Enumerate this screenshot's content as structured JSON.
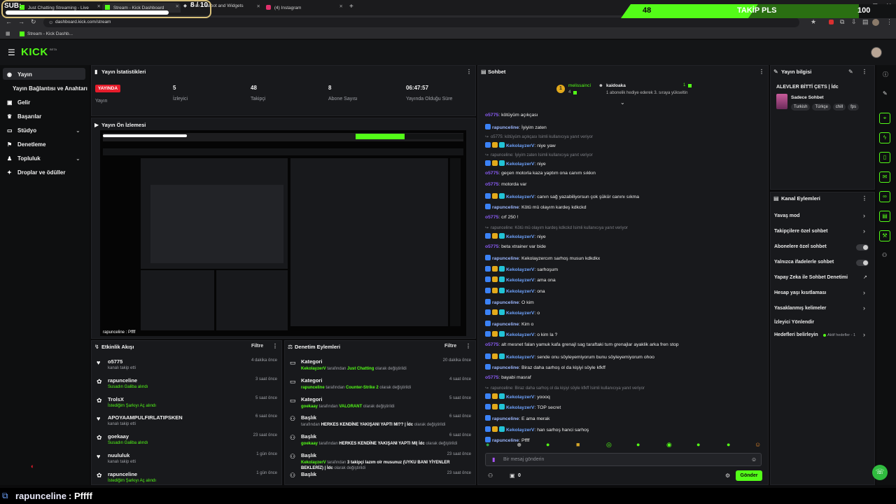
{
  "browser": {
    "tabs": [
      {
        "label": "Just Chatting Streaming - Live"
      },
      {
        "label": "Stream - Kick Dashboard"
      },
      {
        "label": "Free Chatbot and Widgets"
      },
      {
        "label": "(4) Instagram"
      }
    ],
    "url": "dashboard.kick.com/stream",
    "bookmark": "Stream - Kick Dashb..."
  },
  "overlay": {
    "sub_label": "SUB:",
    "sub_count": "8 / 10",
    "follow_count": "48",
    "follow_text": "TAKİP PLS",
    "follow_goal": "100"
  },
  "header": {
    "logo": "KICK",
    "logo_sup": "BETA"
  },
  "sidebar": {
    "items": [
      {
        "label": "Yayın"
      },
      {
        "label": "Yayın Bağlantısı ve Anahtarı"
      },
      {
        "label": "Gelir"
      },
      {
        "label": "Başarılar"
      },
      {
        "label": "Stüdyo"
      },
      {
        "label": "Denetleme"
      },
      {
        "label": "Topluluk"
      },
      {
        "label": "Droplar ve ödüller"
      }
    ]
  },
  "stats": {
    "title": "Yayın İstatistikleri",
    "live_badge": "YAYINDA",
    "items": [
      {
        "value": "",
        "label": "Yayın"
      },
      {
        "value": "5",
        "label": "İzleyici"
      },
      {
        "value": "48",
        "label": "Takipçi"
      },
      {
        "value": "8",
        "label": "Abone Sayısı"
      },
      {
        "value": "06:47:57",
        "label": "Yayında Olduğu Süre"
      }
    ]
  },
  "preview": {
    "title": "Yayın Ön İzlemesi",
    "caption": "rapunceline : Pffff"
  },
  "events": {
    "title": "Etkinlik Akışı",
    "filter": "Filtre",
    "items": [
      {
        "name": "o5775",
        "desc": "kanalı takip etti",
        "time": "4 dakika önce",
        "icon": "heart-icon",
        "green": false
      },
      {
        "name": "rapunceline",
        "desc": "Susadın Galiba alındı",
        "time": "3 saat önce",
        "icon": "reward-icon",
        "green": true
      },
      {
        "name": "TrolsX",
        "desc": "İstediğim Şarkıyı Aç alındı",
        "time": "5 saat önce",
        "icon": "reward-icon",
        "green": true
      },
      {
        "name": "APOYAAMPULFIRLATIPSKEN",
        "desc": "kanalı takip etti",
        "time": "6 saat önce",
        "icon": "heart-icon",
        "green": false
      },
      {
        "name": "goekaay",
        "desc": "Susadın Galiba alındı",
        "time": "23 saat önce",
        "icon": "reward-icon",
        "green": true
      },
      {
        "name": "nuululuk",
        "desc": "kanalı takip etti",
        "time": "1 gün önce",
        "icon": "heart-icon",
        "green": false
      },
      {
        "name": "rapunceline",
        "desc": "İstediğim Şarkıyı Aç alındı",
        "time": "1 gün önce",
        "icon": "reward-icon",
        "green": true
      }
    ]
  },
  "moderation": {
    "title": "Denetim Eylemleri",
    "filter": "Filtre",
    "items": [
      {
        "type": "Kategori",
        "user": "KekolayzerV",
        "mid": " tarafından ",
        "val": "Just Chatting",
        "end": " olarak değiştirildi",
        "time": "20 dakika önce",
        "icon": "category-icon"
      },
      {
        "type": "Kategori",
        "user": "rapunceline",
        "mid": " tarafından ",
        "val": "Counter-Strike 2",
        "end": " olarak değiştirildi",
        "time": "4 saat önce",
        "icon": "category-icon"
      },
      {
        "type": "Kategori",
        "user": "goekaay",
        "mid": " tarafından ",
        "val": "VALORANT",
        "end": " olarak değiştirildi",
        "time": "5 saat önce",
        "icon": "category-icon"
      },
      {
        "type": "Başlık",
        "user": "",
        "mid": "tarafından ",
        "val": "HERKES KENDİNE YAKIŞANI YAPTI MI?? | İdc",
        "end": " olarak değiştirildi",
        "time": "6 saat önce",
        "icon": "title-icon"
      },
      {
        "type": "Başlık",
        "user": "goekaay",
        "mid": " tarafından ",
        "val": "HERKES KENDİNE YAKIŞANI YAPTI MI| İdc",
        "end": " olarak değiştirildi",
        "time": "6 saat önce",
        "icon": "title-icon"
      },
      {
        "type": "Başlık",
        "user": "KekolayzerV",
        "mid": " tarafından ",
        "val": "3 takipçi lazım olr musunuz (UYKU BANI YİYENLER BEKLERİZ) | İdc",
        "end": " olarak değiştirildi",
        "time": "23 saat önce",
        "icon": "title-icon"
      },
      {
        "type": "Başlık",
        "user": "",
        "mid": "",
        "val": "",
        "end": "",
        "time": "23 saat önce",
        "icon": "title-icon"
      }
    ]
  },
  "chat": {
    "title": "Sohbet",
    "pinned": {
      "gifter": "melissaincí",
      "gifter_count": "4",
      "recipient": "kaidoaka",
      "recipient_count": "1",
      "note": "1 abonelik hediye ederek 3. sıraya yükseltin"
    },
    "messages": [
      {
        "kind": "msg",
        "user": "o5775",
        "ucls": "u-purple",
        "text": "kötüyüm açıkçası",
        "badges": 0
      },
      {
        "kind": "msg",
        "user": "rapunceline",
        "ucls": "u-blue",
        "text": "İyiyim zaten",
        "badges": 1
      },
      {
        "kind": "reply",
        "text": "o5775: kötüyüm açıkçası İsimli kullanıcıya yanıt veriyor"
      },
      {
        "kind": "msg",
        "user": "KekolayzerV",
        "ucls": "u-teal",
        "text": "niye yaw",
        "badges": 3
      },
      {
        "kind": "reply",
        "text": "rapunceline: İyiyim zaten İsimli kullanıcıya yanıt veriyor"
      },
      {
        "kind": "msg",
        "user": "KekolayzerV",
        "ucls": "u-teal",
        "text": "niye",
        "badges": 3
      },
      {
        "kind": "msg",
        "user": "o5775",
        "ucls": "u-purple",
        "text": "geçen motorla kaza yaptım ona canım sıkkın",
        "badges": 0
      },
      {
        "kind": "msg",
        "user": "o5775",
        "ucls": "u-purple",
        "text": "motorda var",
        "badges": 0
      },
      {
        "kind": "msg",
        "user": "KekolayzerV",
        "ucls": "u-teal",
        "text": "canın sağ yazabiliyorsun çok şükür canını sıkma",
        "badges": 3
      },
      {
        "kind": "msg",
        "user": "rapunceline",
        "ucls": "u-blue",
        "text": "Kötü mü olayım kardeş kdkckd",
        "badges": 1
      },
      {
        "kind": "msg",
        "user": "o5775",
        "ucls": "u-purple",
        "text": "crf 250 !",
        "badges": 0
      },
      {
        "kind": "reply",
        "text": "rapunceline: Kötü mü olayım kardeş kdkckd İsimli kullanıcıya yanıt veriyor"
      },
      {
        "kind": "msg",
        "user": "KekolayzerV",
        "ucls": "u-teal",
        "text": "niye",
        "badges": 3
      },
      {
        "kind": "msg",
        "user": "o5775",
        "ucls": "u-purple",
        "text": "beta xtrainer var bide",
        "badges": 0
      },
      {
        "kind": "msg",
        "user": "rapunceline",
        "ucls": "u-blue",
        "text": "Kekolayzercım sarhoş musun kdkdkx",
        "badges": 1
      },
      {
        "kind": "msg",
        "user": "KekolayzerV",
        "ucls": "u-teal",
        "text": "sarhoşum",
        "badges": 3
      },
      {
        "kind": "msg",
        "user": "KekolayzerV",
        "ucls": "u-teal",
        "text": "ama ona",
        "badges": 3
      },
      {
        "kind": "msg",
        "user": "KekolayzerV",
        "ucls": "u-teal",
        "text": "ona",
        "badges": 3
      },
      {
        "kind": "msg",
        "user": "rapunceline",
        "ucls": "u-blue",
        "text": "O kim",
        "badges": 1
      },
      {
        "kind": "msg",
        "user": "KekolayzerV",
        "ucls": "u-teal",
        "text": "o",
        "badges": 3
      },
      {
        "kind": "msg",
        "user": "rapunceline",
        "ucls": "u-blue",
        "text": "Kim o",
        "badges": 1
      },
      {
        "kind": "msg",
        "user": "KekolayzerV",
        "ucls": "u-teal",
        "text": "o kim la ?",
        "badges": 3
      },
      {
        "kind": "msg",
        "user": "o5775",
        "ucls": "u-purple",
        "text": "alt mesnet falan yamuk kafa grenajl sag taraftaki tum grenajlar ayaklik arka fren stop",
        "badges": 0
      },
      {
        "kind": "msg",
        "user": "KekolayzerV",
        "ucls": "u-teal",
        "text": "sende onu söyleyemiyorum bunu söyleyemiyorum ohoo",
        "badges": 3
      },
      {
        "kind": "msg",
        "user": "rapunceline",
        "ucls": "u-blue",
        "text": "Biraz daha sarhoş ol da kişiyi söyle kfkff",
        "badges": 1
      },
      {
        "kind": "msg",
        "user": "o5775",
        "ucls": "u-purple",
        "text": "bayabi masraf",
        "badges": 0
      },
      {
        "kind": "reply",
        "text": "rapunceline: Biraz daha sarhoş ol da kişiyi söyle kfkff İsimli kullanıcıya yanıt veriyor"
      },
      {
        "kind": "msg",
        "user": "KekolayzerV",
        "ucls": "u-teal",
        "text": "yoooq",
        "badges": 3
      },
      {
        "kind": "msg",
        "user": "KekolayzerV",
        "ucls": "u-teal",
        "text": "TOP secret",
        "badges": 3
      },
      {
        "kind": "msg",
        "user": "rapunceline",
        "ucls": "u-blue",
        "text": "E ama merak",
        "badges": 1
      },
      {
        "kind": "msg",
        "user": "KekolayzerV",
        "ucls": "u-teal",
        "text": "han sarhoş hanci sarhoş",
        "badges": 3
      },
      {
        "kind": "msg",
        "user": "rapunceline",
        "ucls": "u-blue",
        "text": "Pffff",
        "badges": 1
      }
    ],
    "input_placeholder": "Bir mesaj gönderin",
    "send_label": "Gönder",
    "points": "0"
  },
  "stream_info": {
    "title": "Yayın bilgisi",
    "stream_title": "ALEVLER BİTTİ ÇETS | İdc",
    "category": "Sadece Sohbet",
    "tags": [
      "Turkish",
      "Türkçe",
      "chill",
      "fps"
    ]
  },
  "channel_actions": {
    "title": "Kanal Eylemleri",
    "items": [
      {
        "label": "Yavaş mod",
        "control": "chevron"
      },
      {
        "label": "Takipçilere özel sohbet",
        "control": "chevron"
      },
      {
        "label": "Abonelere özel sohbet",
        "control": "toggle"
      },
      {
        "label": "Yalnızca ifadelerle sohbet",
        "control": "toggle"
      },
      {
        "label": "Yapay Zeka ile Sohbet Denetimi",
        "control": "external"
      },
      {
        "label": "Hesap yaşı kısıtlaması",
        "control": "chevron"
      },
      {
        "label": "Yasaklanmış kelimeler",
        "control": "chevron"
      },
      {
        "label": "İzleyici Yönlendir",
        "control": "none"
      },
      {
        "label": "Hedefleri belirleyin",
        "control": "chevron",
        "extra": "Aktif hedefler - 1"
      }
    ]
  },
  "bottom_caption": {
    "user": "rapunceline",
    "text": " : Pffff"
  },
  "colors": {
    "accent": "#53fc18",
    "live": "#e61c2b",
    "panel": "#18191c",
    "bg": "#0b0b0c"
  }
}
